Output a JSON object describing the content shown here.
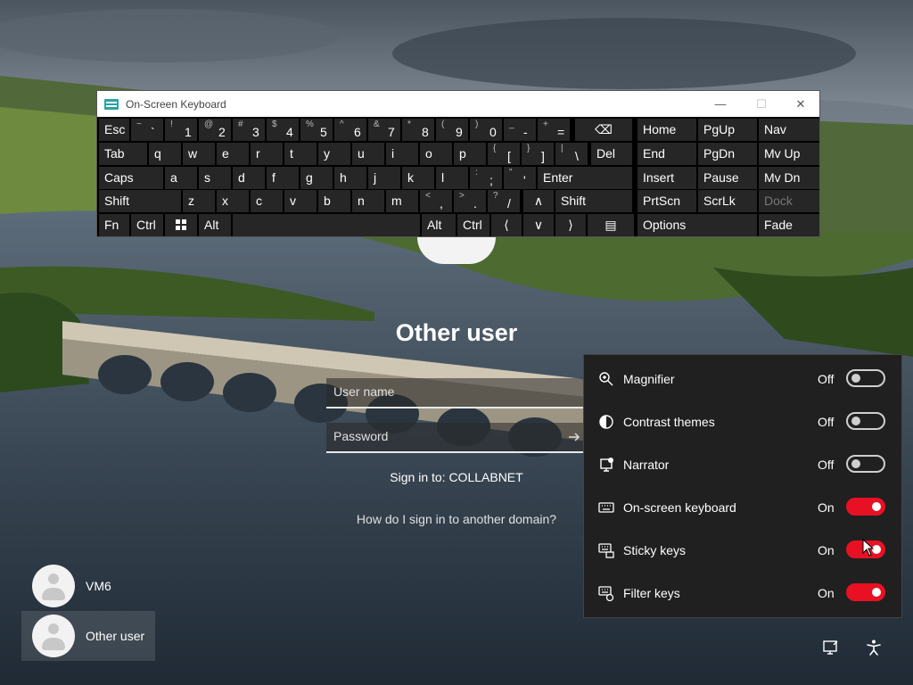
{
  "osk": {
    "title": "On-Screen Keyboard",
    "minimize_icon": "minimize-icon",
    "maximize_icon": "maximize-icon",
    "close_icon": "close-icon",
    "keys": {
      "esc": "Esc",
      "tab": "Tab",
      "caps": "Caps",
      "lshift": "Shift",
      "fn": "Fn",
      "lctrl": "Ctrl",
      "alt_l": "Alt",
      "alt_r": "Alt",
      "rctrl": "Ctrl",
      "del": "Del",
      "enter": "Enter",
      "rshift": "Shift",
      "home": "Home",
      "pgup": "PgUp",
      "nav": "Nav",
      "end": "End",
      "pgdn": "PgDn",
      "mvup": "Mv Up",
      "insert": "Insert",
      "pause": "Pause",
      "mvdn": "Mv Dn",
      "prtscn": "PrtScn",
      "scrlk": "ScrLk",
      "dock": "Dock",
      "options": "Options",
      "fade": "Fade",
      "row1": [
        {
          "shift": "~",
          "main": "`"
        },
        {
          "shift": "!",
          "main": "1"
        },
        {
          "shift": "@",
          "main": "2"
        },
        {
          "shift": "#",
          "main": "3"
        },
        {
          "shift": "$",
          "main": "4"
        },
        {
          "shift": "%",
          "main": "5"
        },
        {
          "shift": "^",
          "main": "6"
        },
        {
          "shift": "&",
          "main": "7"
        },
        {
          "shift": "*",
          "main": "8"
        },
        {
          "shift": "(",
          "main": "9"
        },
        {
          "shift": ")",
          "main": "0"
        },
        {
          "shift": "_",
          "main": "-"
        },
        {
          "shift": "+",
          "main": "="
        }
      ],
      "row2": [
        "q",
        "w",
        "e",
        "r",
        "t",
        "y",
        "u",
        "i",
        "o",
        "p"
      ],
      "row2_sym": [
        {
          "shift": "{",
          "main": "["
        },
        {
          "shift": "}",
          "main": "]"
        },
        {
          "shift": "|",
          "main": "\\"
        }
      ],
      "row3": [
        "a",
        "s",
        "d",
        "f",
        "g",
        "h",
        "j",
        "k",
        "l"
      ],
      "row3_sym": [
        {
          "shift": ":",
          "main": ";"
        },
        {
          "shift": "\"",
          "main": "'"
        }
      ],
      "row4": [
        "z",
        "x",
        "c",
        "v",
        "b",
        "n",
        "m"
      ],
      "row4_sym": [
        {
          "shift": "<",
          "main": ","
        },
        {
          "shift": ">",
          "main": "."
        },
        {
          "shift": "?",
          "main": "/"
        }
      ]
    }
  },
  "login": {
    "title": "Other user",
    "username_placeholder": "User name",
    "password_placeholder": "Password",
    "signin_to": "Sign in to: COLLABNET",
    "other_domain_link": "How do I sign in to another domain?"
  },
  "users": [
    {
      "name": "VM6"
    },
    {
      "name": "Other user"
    }
  ],
  "accessibility": {
    "items": [
      {
        "label": "Magnifier",
        "state": "Off",
        "on": false,
        "icon": "magnifier-icon"
      },
      {
        "label": "Contrast themes",
        "state": "Off",
        "on": false,
        "icon": "contrast-icon"
      },
      {
        "label": "Narrator",
        "state": "Off",
        "on": false,
        "icon": "narrator-icon"
      },
      {
        "label": "On-screen keyboard",
        "state": "On",
        "on": true,
        "icon": "keyboard-icon"
      },
      {
        "label": "Sticky keys",
        "state": "On",
        "on": true,
        "icon": "sticky-keys-icon"
      },
      {
        "label": "Filter keys",
        "state": "On",
        "on": true,
        "icon": "filter-keys-icon"
      }
    ]
  },
  "colors": {
    "toggle_on": "#e81123",
    "flyout_bg": "#202020",
    "key_bg": "#262626"
  }
}
